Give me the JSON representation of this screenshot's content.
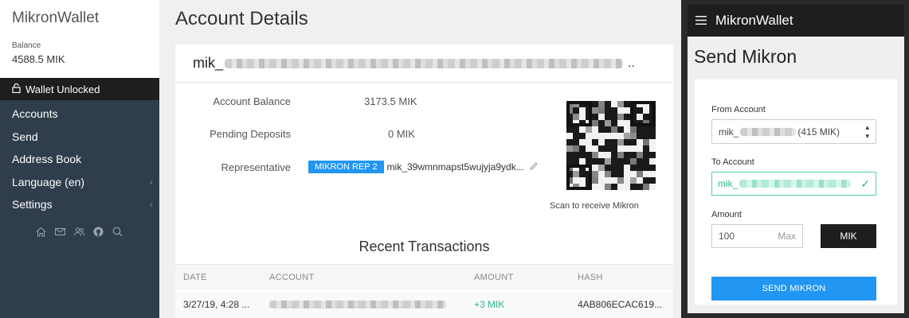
{
  "sidebar": {
    "app_title": "MikronWallet",
    "balance_label": "Balance",
    "balance_value": "4588.5 MIK",
    "wallet_status": "Wallet Unlocked",
    "items": [
      {
        "label": "Accounts",
        "chevron": false
      },
      {
        "label": "Send",
        "chevron": false
      },
      {
        "label": "Address Book",
        "chevron": false
      },
      {
        "label": "Language (en)",
        "chevron": true
      },
      {
        "label": "Settings",
        "chevron": true
      }
    ],
    "footer_icons": [
      "home-icon",
      "mail-icon",
      "users-icon",
      "github-icon",
      "search-icon"
    ]
  },
  "main": {
    "title": "Account Details",
    "account_prefix": "mik_",
    "account_ellipsis": "..",
    "details": {
      "balance_label": "Account Balance",
      "balance_value": "3173.5 MIK",
      "pending_label": "Pending Deposits",
      "pending_value": "0 MIK",
      "rep_label": "Representative",
      "rep_badge": "MIKRON REP 2",
      "rep_address": "mik_39wmnmapst5wujyja9ydk..."
    },
    "qr_caption": "Scan to receive Mikron",
    "recent_title": "Recent Transactions",
    "table": {
      "headers": {
        "date": "DATE",
        "account": "ACCOUNT",
        "amount": "AMOUNT",
        "hash": "HASH"
      },
      "rows": [
        {
          "date": "3/27/19, 4:28 ...",
          "amount": "+3 MIK",
          "hash": "4AB806ECAC619..."
        }
      ]
    }
  },
  "send_panel": {
    "app_title": "MikronWallet",
    "title": "Send Mikron",
    "from_label": "From Account",
    "from_prefix": "mik_",
    "from_suffix": "(415 MIK)",
    "to_label": "To Account",
    "to_prefix": "mik_",
    "amount_label": "Amount",
    "amount_value": "100",
    "max_label": "Max",
    "currency": "MIK",
    "send_button": "SEND MIKRON"
  },
  "colors": {
    "sidebar_bg": "#2f3d4c",
    "accent_blue": "#2196f3",
    "positive_green": "#2eb88a",
    "dark_bar": "#1e1e1e"
  }
}
